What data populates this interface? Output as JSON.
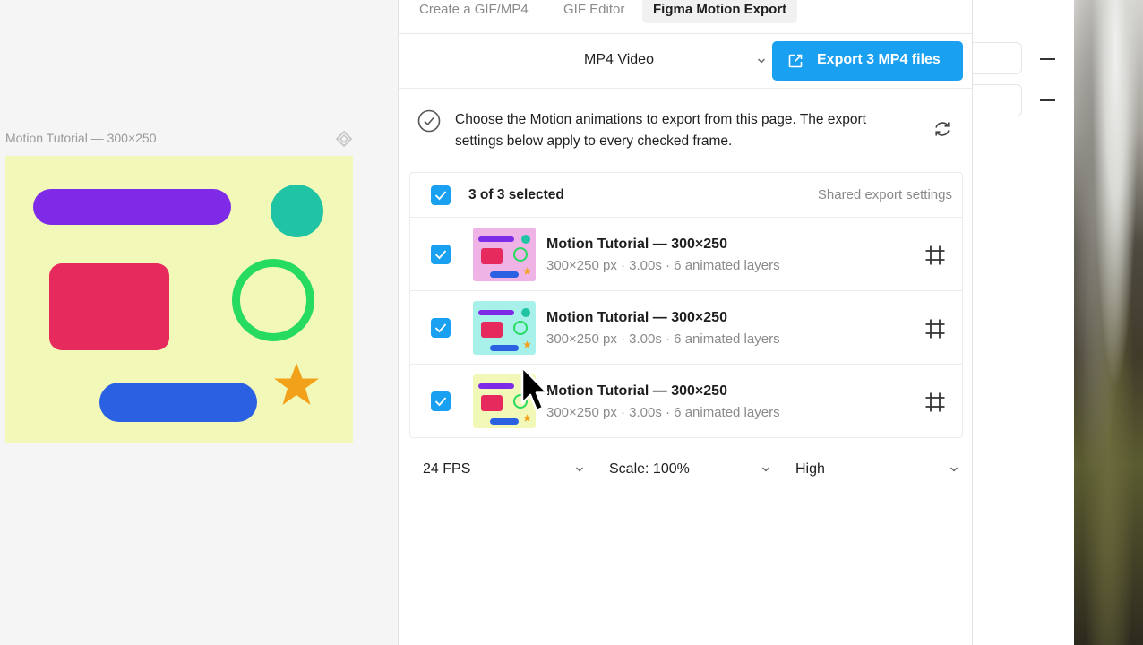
{
  "canvas": {
    "frame_label": "Motion Tutorial — 300×250",
    "frame_background": "#f1f8b8",
    "component_icon": "component-diamond-icon"
  },
  "panel": {
    "tabs": [
      {
        "label": "Create a GIF/MP4",
        "active": false
      },
      {
        "label": "GIF Editor",
        "active": false
      },
      {
        "label": "Figma Motion Export",
        "active": true
      }
    ],
    "format": {
      "selected": "MP4 Video",
      "icon": "chevron-down-icon"
    },
    "export_button": {
      "label": "Export 3 MP4 files",
      "icon": "external-link-icon",
      "color": "#1aa0f0"
    },
    "info": {
      "icon": "check-circle-icon",
      "text": "Choose the Motion animations to export from this page. The export settings below apply to every checked frame.",
      "refresh_icon": "refresh-icon"
    },
    "list": {
      "header": {
        "checked": true,
        "count_label": "3 of 3 selected",
        "shared_label": "Shared export settings"
      },
      "items": [
        {
          "title": "Motion Tutorial — 300×250",
          "meta": "300×250 px · 3.00s · 6 animated layers",
          "checked": true,
          "thumb_bg": "#f0b3e6",
          "icon": "frame-icon"
        },
        {
          "title": "Motion Tutorial — 300×250",
          "meta": "300×250 px · 3.00s · 6 animated layers",
          "checked": true,
          "thumb_bg": "#a8f0ea",
          "icon": "frame-icon"
        },
        {
          "title": "Motion Tutorial — 300×250",
          "meta": "300×250 px · 3.00s · 6 animated layers",
          "checked": true,
          "thumb_bg": "#f1f8b8",
          "icon": "frame-icon"
        }
      ]
    },
    "settings": {
      "fps": "24 FPS",
      "scale": "Scale: 100%",
      "quality": "High"
    }
  },
  "colors": {
    "accent": "#1aa0f0",
    "purple": "#7f2ae6",
    "teal": "#20c4a5",
    "red": "#e72a5d",
    "green": "#26db60",
    "blue": "#2a61e3",
    "star": "#f2a21a"
  }
}
